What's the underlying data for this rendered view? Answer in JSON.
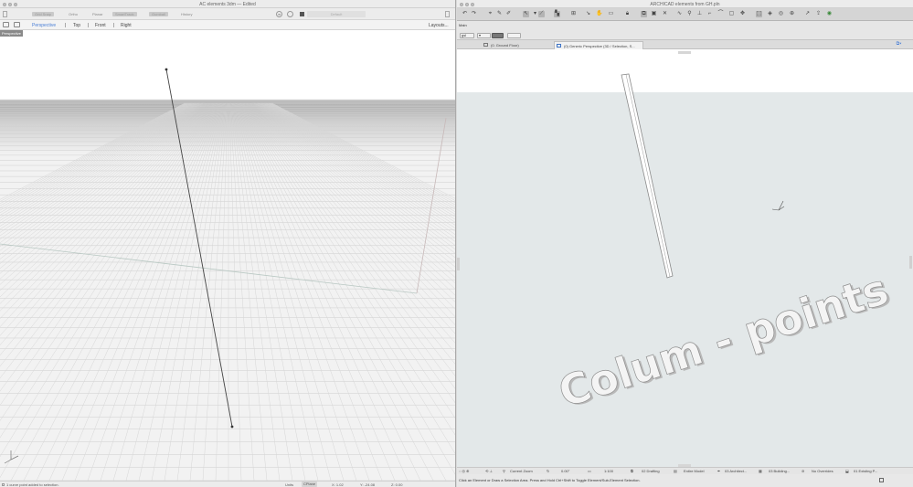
{
  "rhino": {
    "title": "AC elements 3dm — Edited",
    "toolbar": [
      "Grid Snap",
      "Ortho",
      "Planar",
      "SmartTrack",
      "Gumball",
      "History"
    ],
    "toolbar_dark": [
      true,
      false,
      false,
      true,
      true,
      false
    ],
    "command_placeholder": "Default",
    "views": [
      "Perspective",
      "Top",
      "Front",
      "Right"
    ],
    "layouts": "Layouts...",
    "viewport_label": "Perspective",
    "status": "1 curve point added to selection.",
    "units": "Units",
    "cplane": "CPlane",
    "x": "X: 1.02",
    "y": "Y: -24.08",
    "z": "Z: 0.00"
  },
  "archicad": {
    "title": "ARCHICAD elements from GH.pln",
    "main_label": "Main",
    "info": [
      "gsl",
      "▾"
    ],
    "tabs": [
      "(0. Ground Floor)",
      "(0) Generic Perspective (3D / Selection, S..."
    ],
    "text3d": "Colum - points",
    "bottom": [
      "Current Zoom",
      "0.00°",
      "1:100",
      "02 Drafting",
      "Entire Model",
      "03 Architect...",
      "03 Building...",
      "No Overrides",
      "01 Existing P..."
    ],
    "status": "Click an Element or Draw a Selection Area. Press and Hold Ctrl+Shift to Toggle Element/Sub-Element Selection."
  },
  "colors": {
    "accent": "#4a7fd6",
    "ac_canvas": "#e3e8e9"
  }
}
